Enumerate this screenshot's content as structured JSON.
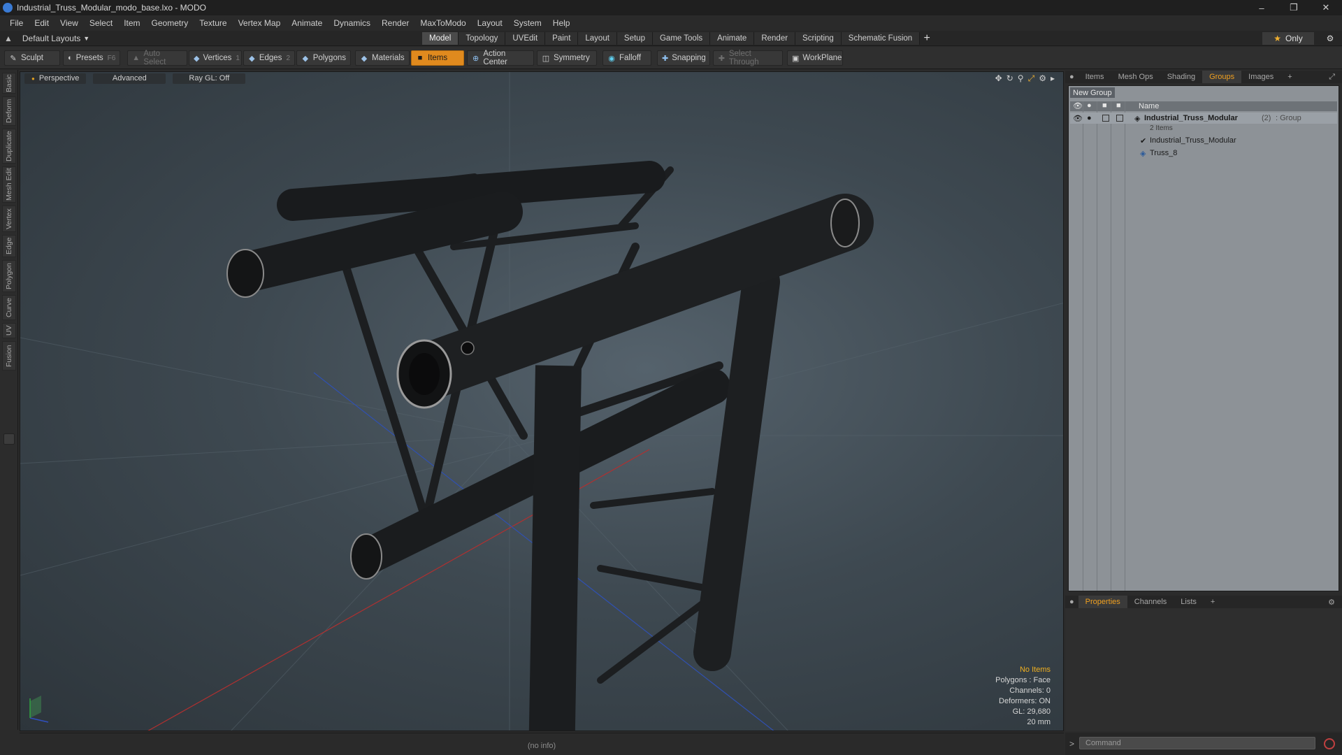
{
  "window": {
    "title": "Industrial_Truss_Modular_modo_base.lxo - MODO",
    "controls": [
      "minimize-icon",
      "restore-icon",
      "close-icon"
    ]
  },
  "menu": [
    "File",
    "Edit",
    "View",
    "Select",
    "Item",
    "Geometry",
    "Texture",
    "Vertex Map",
    "Animate",
    "Dynamics",
    "Render",
    "MaxToModo",
    "Layout",
    "System",
    "Help"
  ],
  "layoutbar": {
    "layout_selector": "Default Layouts",
    "tabs": [
      "Model",
      "Topology",
      "UVEdit",
      "Paint",
      "Layout",
      "Setup",
      "Game Tools",
      "Animate",
      "Render",
      "Scripting",
      "Schematic Fusion"
    ],
    "active_tab": "Model",
    "only_label": "Only"
  },
  "toolbar": {
    "sculpt": "Sculpt",
    "presets": "Presets",
    "presets_key": "F6",
    "auto_select": "Auto Select",
    "vertices": "Vertices",
    "vertices_count": "1",
    "edges": "Edges",
    "edges_count": "2",
    "polygons": "Polygons",
    "materials": "Materials",
    "items": "Items",
    "action_center": "Action Center",
    "symmetry": "Symmetry",
    "falloff": "Falloff",
    "snapping": "Snapping",
    "select_through": "Select Through",
    "workplane": "WorkPlane"
  },
  "left_tabs": [
    "Basic",
    "Deform",
    "Duplicate",
    "Mesh Edit",
    "Vertex",
    "Edge",
    "Polygon",
    "Curve",
    "UV",
    "Fusion"
  ],
  "viewport": {
    "view": "Perspective",
    "shading": "Advanced",
    "raygl": "Ray GL: Off",
    "stats": {
      "selection": "No Items",
      "polygons": "Polygons : Face",
      "channels": "Channels: 0",
      "deformers": "Deformers: ON",
      "gl": "GL: 29,680",
      "scale": "20 mm"
    }
  },
  "right_panel": {
    "tabs": [
      "Items",
      "Mesh Ops",
      "Shading",
      "Groups",
      "Images"
    ],
    "active_tab": "Groups",
    "new_group": "New Group",
    "name_header": "Name",
    "tree": {
      "group_name": "Industrial_Truss_Modular",
      "group_count": "(2)",
      "group_type": ": Group",
      "group_sub": "2 Items",
      "child1": "Industrial_Truss_Modular",
      "child2": "Truss_8"
    }
  },
  "props": {
    "tabs": [
      "Properties",
      "Channels",
      "Lists"
    ],
    "active_tab": "Properties"
  },
  "command": {
    "placeholder": "Command"
  },
  "status": {
    "info": "(no info)"
  },
  "colors": {
    "accent": "#e08a1e",
    "active_tab_text": "#f0a020",
    "stats_highlight": "#f0b020"
  }
}
